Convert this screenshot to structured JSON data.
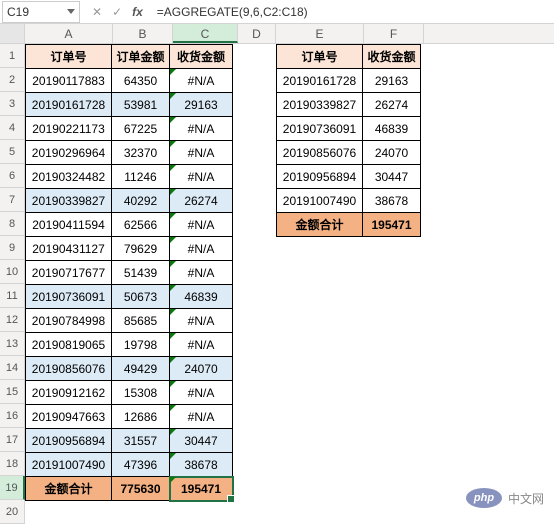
{
  "name_box": "C19",
  "formula": "=AGGREGATE(9,6,C2:C18)",
  "columns": [
    "A",
    "B",
    "C",
    "D",
    "E",
    "F"
  ],
  "rows": [
    "1",
    "2",
    "3",
    "4",
    "5",
    "6",
    "7",
    "8",
    "9",
    "10",
    "11",
    "12",
    "13",
    "14",
    "15",
    "16",
    "17",
    "18",
    "19",
    "20"
  ],
  "main": {
    "headers": [
      "订单号",
      "订单金额",
      "收货金额"
    ],
    "data": [
      [
        "20190117883",
        "64350",
        "#N/A"
      ],
      [
        "20190161728",
        "53981",
        "29163"
      ],
      [
        "20190221173",
        "67225",
        "#N/A"
      ],
      [
        "20190296964",
        "32370",
        "#N/A"
      ],
      [
        "20190324482",
        "11246",
        "#N/A"
      ],
      [
        "20190339827",
        "40292",
        "26274"
      ],
      [
        "20190411594",
        "62566",
        "#N/A"
      ],
      [
        "20190431127",
        "79629",
        "#N/A"
      ],
      [
        "20190717677",
        "51439",
        "#N/A"
      ],
      [
        "20190736091",
        "50673",
        "46839"
      ],
      [
        "20190784998",
        "85685",
        "#N/A"
      ],
      [
        "20190819065",
        "19798",
        "#N/A"
      ],
      [
        "20190856076",
        "49429",
        "24070"
      ],
      [
        "20190912162",
        "15308",
        "#N/A"
      ],
      [
        "20190947663",
        "12686",
        "#N/A"
      ],
      [
        "20190956894",
        "31557",
        "30447"
      ],
      [
        "20191007490",
        "47396",
        "38678"
      ]
    ],
    "sum_label": "金额合计",
    "sum_b": "775630",
    "sum_c": "195471",
    "alt_rows": [
      1,
      5,
      9,
      12,
      15,
      16
    ]
  },
  "side": {
    "headers": [
      "订单号",
      "收货金额"
    ],
    "data": [
      [
        "20190161728",
        "29163"
      ],
      [
        "20190339827",
        "26274"
      ],
      [
        "20190736091",
        "46839"
      ],
      [
        "20190856076",
        "24070"
      ],
      [
        "20190956894",
        "30447"
      ],
      [
        "20191007490",
        "38678"
      ]
    ],
    "sum_label": "金额合计",
    "sum_f": "195471"
  },
  "watermark": "中文网"
}
